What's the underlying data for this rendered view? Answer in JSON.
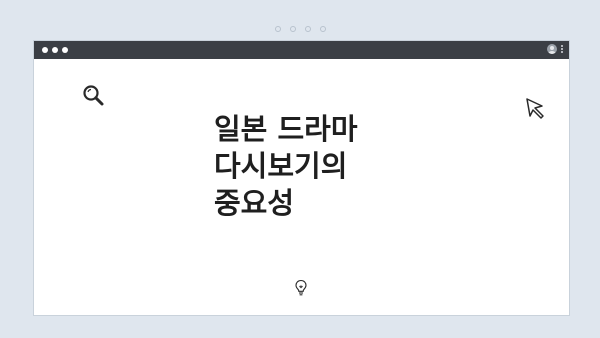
{
  "window": {
    "title_dots": [
      "red",
      "yellow",
      "green"
    ]
  },
  "content": {
    "heading_lines": [
      "일본 드라마",
      "다시보기의",
      "중요성"
    ]
  },
  "icons": {
    "search": "search-icon",
    "cursor": "cursor-arrow-icon",
    "bulb": "lightbulb-icon",
    "profile": "profile-icon",
    "menu": "kebab-menu-icon"
  },
  "colors": {
    "background": "#dfe6ee",
    "titlebar": "#3b3f45",
    "text": "#1f1f1f"
  }
}
